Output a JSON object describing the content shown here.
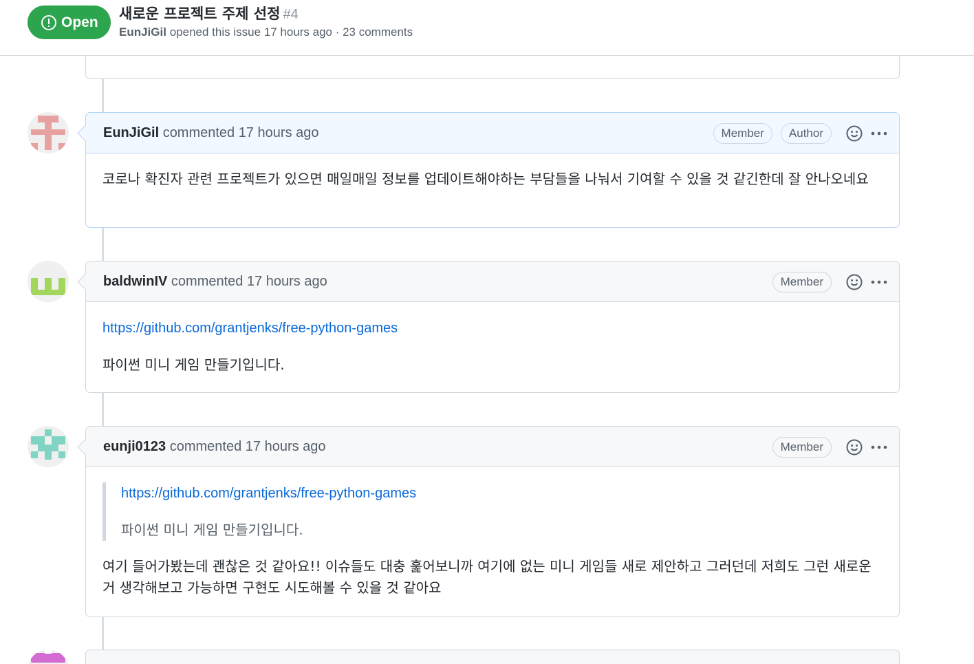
{
  "header": {
    "state_label": "Open",
    "title": "새로운 프로젝트 주제 선정",
    "number": "#4",
    "author": "EunJiGil",
    "meta_text": "opened this issue 17 hours ago · 23 comments"
  },
  "comments": [
    {
      "login": "EunJiGil",
      "action": "commented 17 hours ago",
      "badges": [
        "Member",
        "Author"
      ],
      "body": "코로나 확진자 관련 프로젝트가 있으면 매일매일 정보를 업데이트해야하는 부담들을 나눠서 기여할 수 있을 것 같긴한데 잘 안나오네요",
      "avatar_color": "#e8a1a1"
    },
    {
      "login": "baldwinIV",
      "action": "commented 17 hours ago",
      "badges": [
        "Member"
      ],
      "link": "https://github.com/grantjenks/free-python-games",
      "body": "파이썬 미니 게임 만들기입니다.",
      "avatar_color": "#a3d65c"
    },
    {
      "login": "eunji0123",
      "action": "commented 17 hours ago",
      "badges": [
        "Member"
      ],
      "quote_link": "https://github.com/grantjenks/free-python-games",
      "quote_text": "파이썬 미니 게임 만들기입니다.",
      "body": "여기 들어가봤는데 괜찮은 것 같아요!! 이슈들도 대충 훑어보니까 여기에 없는 미니 게임들 새로 제안하고 그러던데 저희도 그런 새로운 거 생각해보고 가능하면 구현도 시도해볼 수 있을 것 같아요",
      "avatar_color": "#7fd4c4"
    }
  ],
  "icons": {
    "state": "issue-opened-icon",
    "reaction": "smiley-icon",
    "more": "kebab-horizontal-icon"
  }
}
